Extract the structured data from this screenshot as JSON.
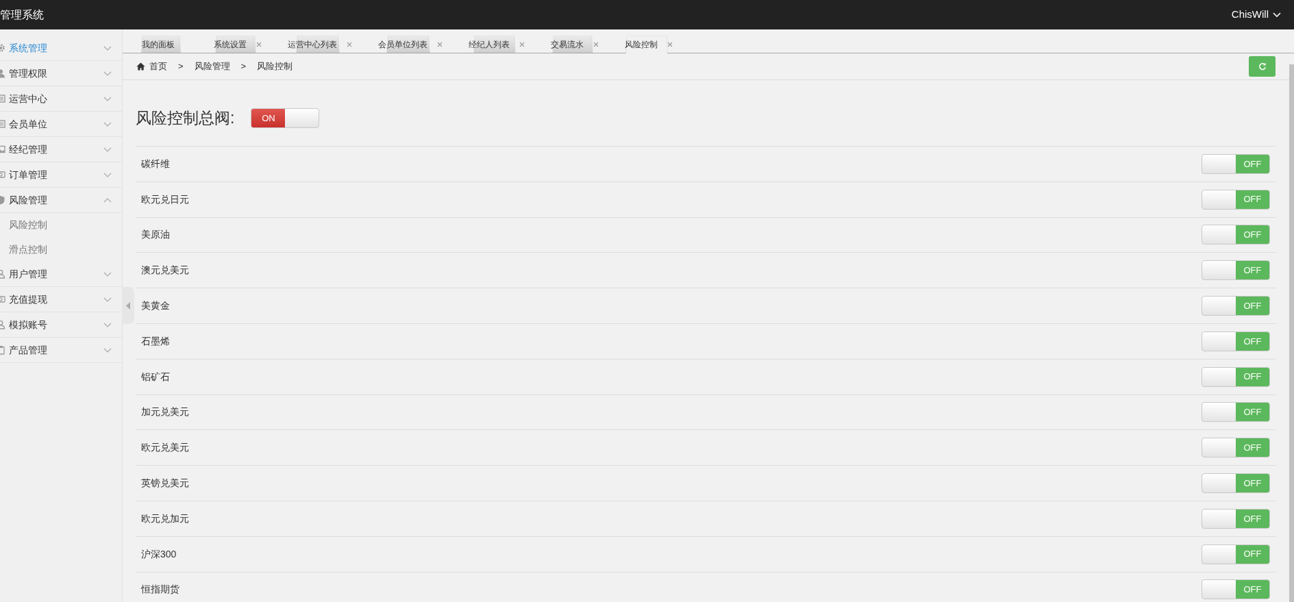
{
  "topbar": {
    "title": "管理系统",
    "user": "ChisWill"
  },
  "sidebar": {
    "items": [
      {
        "label": "系统管理",
        "selected": true,
        "expanded": false
      },
      {
        "label": "管理权限",
        "selected": false,
        "expanded": false
      },
      {
        "label": "运营中心",
        "selected": false,
        "expanded": false
      },
      {
        "label": "会员单位",
        "selected": false,
        "expanded": false
      },
      {
        "label": "经纪管理",
        "selected": false,
        "expanded": false
      },
      {
        "label": "订单管理",
        "selected": false,
        "expanded": false
      },
      {
        "label": "风险管理",
        "selected": false,
        "expanded": true,
        "children": [
          {
            "label": "风险控制",
            "selected": false
          },
          {
            "label": "滑点控制",
            "selected": false
          }
        ]
      },
      {
        "label": "用户管理",
        "selected": false,
        "expanded": false
      },
      {
        "label": "充值提现",
        "selected": false,
        "expanded": false
      },
      {
        "label": "模拟账号",
        "selected": false,
        "expanded": false
      },
      {
        "label": "产品管理",
        "selected": false,
        "expanded": false
      }
    ]
  },
  "tabs": [
    {
      "label": "我的面板",
      "selected": false,
      "closable": false
    },
    {
      "label": "系统设置",
      "selected": false,
      "closable": true
    },
    {
      "label": "运营中心列表",
      "selected": false,
      "closable": true
    },
    {
      "label": "会员单位列表",
      "selected": false,
      "closable": true
    },
    {
      "label": "经纪人列表",
      "selected": false,
      "closable": true
    },
    {
      "label": "交易流水",
      "selected": false,
      "closable": true
    },
    {
      "label": "风险控制",
      "selected": true,
      "closable": true
    }
  ],
  "breadcrumb": [
    {
      "kind": "home",
      "text": "首页"
    },
    {
      "kind": "separator",
      "text": ">"
    },
    {
      "kind": "link",
      "text": "风险管理"
    },
    {
      "kind": "separator",
      "text": ">"
    },
    {
      "kind": "current",
      "text": "风险控制"
    }
  ],
  "master": {
    "title": "风险控制总阀:",
    "switch": {
      "on": true,
      "text": "ON"
    }
  },
  "rows": [
    {
      "label": "碳纤维",
      "switch": {
        "on": false,
        "text": "OFF"
      }
    },
    {
      "label": "欧元兑日元",
      "switch": {
        "on": false,
        "text": "OFF"
      }
    },
    {
      "label": "美原油",
      "switch": {
        "on": false,
        "text": "OFF"
      }
    },
    {
      "label": "澳元兑美元",
      "switch": {
        "on": false,
        "text": "OFF"
      }
    },
    {
      "label": "美黄金",
      "switch": {
        "on": false,
        "text": "OFF"
      }
    },
    {
      "label": "石墨烯",
      "switch": {
        "on": false,
        "text": "OFF"
      }
    },
    {
      "label": "铝矿石",
      "switch": {
        "on": false,
        "text": "OFF"
      }
    },
    {
      "label": "加元兑美元",
      "switch": {
        "on": false,
        "text": "OFF"
      }
    },
    {
      "label": "欧元兑美元",
      "switch": {
        "on": false,
        "text": "OFF"
      }
    },
    {
      "label": "英镑兑美元",
      "switch": {
        "on": false,
        "text": "OFF"
      }
    },
    {
      "label": "欧元兑加元",
      "switch": {
        "on": false,
        "text": "OFF"
      }
    },
    {
      "label": "沪深300",
      "switch": {
        "on": false,
        "text": "OFF"
      }
    },
    {
      "label": "恒指期货",
      "switch": {
        "on": false,
        "text": "OFF"
      }
    }
  ]
}
